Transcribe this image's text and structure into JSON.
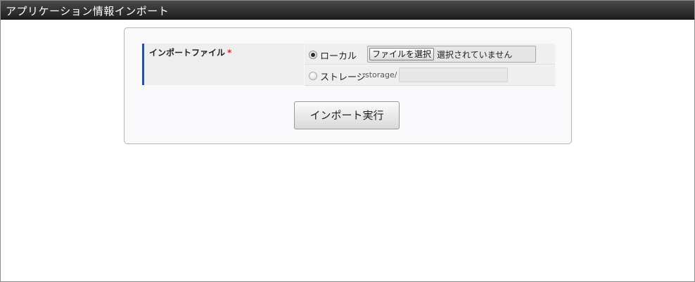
{
  "window": {
    "title": "アプリケーション情報インポート"
  },
  "form": {
    "field_label": "インポートファイル",
    "required_mark": "*",
    "options": {
      "local": {
        "label": "ローカル",
        "selected": true,
        "file_button_label": "ファイルを選択",
        "file_status": "選択されていません"
      },
      "storage": {
        "label": "ストレージ",
        "selected": false,
        "path_prefix": "storage/",
        "path_value": ""
      }
    },
    "submit_label": "インポート実行"
  },
  "colors": {
    "title_bar": "#2b2b2b",
    "label_accent": "#2e4f8d",
    "required": "#d9262f"
  },
  "icons": {
    "radio_local": "radio-checked",
    "radio_storage": "radio-unchecked"
  }
}
